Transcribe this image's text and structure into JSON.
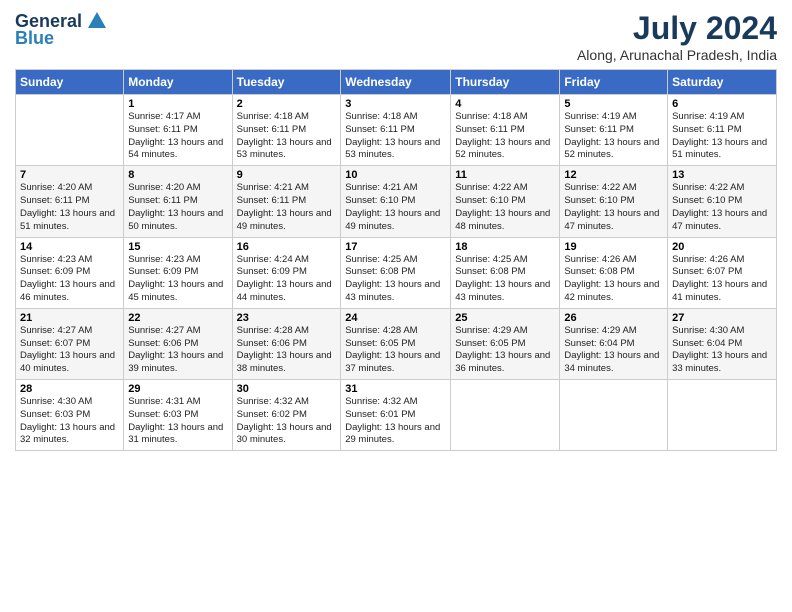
{
  "logo": {
    "general": "General",
    "blue": "Blue"
  },
  "title": "July 2024",
  "subtitle": "Along, Arunachal Pradesh, India",
  "days_of_week": [
    "Sunday",
    "Monday",
    "Tuesday",
    "Wednesday",
    "Thursday",
    "Friday",
    "Saturday"
  ],
  "weeks": [
    [
      {
        "num": "",
        "sunrise": "",
        "sunset": "",
        "daylight": ""
      },
      {
        "num": "1",
        "sunrise": "Sunrise: 4:17 AM",
        "sunset": "Sunset: 6:11 PM",
        "daylight": "Daylight: 13 hours and 54 minutes."
      },
      {
        "num": "2",
        "sunrise": "Sunrise: 4:18 AM",
        "sunset": "Sunset: 6:11 PM",
        "daylight": "Daylight: 13 hours and 53 minutes."
      },
      {
        "num": "3",
        "sunrise": "Sunrise: 4:18 AM",
        "sunset": "Sunset: 6:11 PM",
        "daylight": "Daylight: 13 hours and 53 minutes."
      },
      {
        "num": "4",
        "sunrise": "Sunrise: 4:18 AM",
        "sunset": "Sunset: 6:11 PM",
        "daylight": "Daylight: 13 hours and 52 minutes."
      },
      {
        "num": "5",
        "sunrise": "Sunrise: 4:19 AM",
        "sunset": "Sunset: 6:11 PM",
        "daylight": "Daylight: 13 hours and 52 minutes."
      },
      {
        "num": "6",
        "sunrise": "Sunrise: 4:19 AM",
        "sunset": "Sunset: 6:11 PM",
        "daylight": "Daylight: 13 hours and 51 minutes."
      }
    ],
    [
      {
        "num": "7",
        "sunrise": "Sunrise: 4:20 AM",
        "sunset": "Sunset: 6:11 PM",
        "daylight": "Daylight: 13 hours and 51 minutes."
      },
      {
        "num": "8",
        "sunrise": "Sunrise: 4:20 AM",
        "sunset": "Sunset: 6:11 PM",
        "daylight": "Daylight: 13 hours and 50 minutes."
      },
      {
        "num": "9",
        "sunrise": "Sunrise: 4:21 AM",
        "sunset": "Sunset: 6:11 PM",
        "daylight": "Daylight: 13 hours and 49 minutes."
      },
      {
        "num": "10",
        "sunrise": "Sunrise: 4:21 AM",
        "sunset": "Sunset: 6:10 PM",
        "daylight": "Daylight: 13 hours and 49 minutes."
      },
      {
        "num": "11",
        "sunrise": "Sunrise: 4:22 AM",
        "sunset": "Sunset: 6:10 PM",
        "daylight": "Daylight: 13 hours and 48 minutes."
      },
      {
        "num": "12",
        "sunrise": "Sunrise: 4:22 AM",
        "sunset": "Sunset: 6:10 PM",
        "daylight": "Daylight: 13 hours and 47 minutes."
      },
      {
        "num": "13",
        "sunrise": "Sunrise: 4:22 AM",
        "sunset": "Sunset: 6:10 PM",
        "daylight": "Daylight: 13 hours and 47 minutes."
      }
    ],
    [
      {
        "num": "14",
        "sunrise": "Sunrise: 4:23 AM",
        "sunset": "Sunset: 6:09 PM",
        "daylight": "Daylight: 13 hours and 46 minutes."
      },
      {
        "num": "15",
        "sunrise": "Sunrise: 4:23 AM",
        "sunset": "Sunset: 6:09 PM",
        "daylight": "Daylight: 13 hours and 45 minutes."
      },
      {
        "num": "16",
        "sunrise": "Sunrise: 4:24 AM",
        "sunset": "Sunset: 6:09 PM",
        "daylight": "Daylight: 13 hours and 44 minutes."
      },
      {
        "num": "17",
        "sunrise": "Sunrise: 4:25 AM",
        "sunset": "Sunset: 6:08 PM",
        "daylight": "Daylight: 13 hours and 43 minutes."
      },
      {
        "num": "18",
        "sunrise": "Sunrise: 4:25 AM",
        "sunset": "Sunset: 6:08 PM",
        "daylight": "Daylight: 13 hours and 43 minutes."
      },
      {
        "num": "19",
        "sunrise": "Sunrise: 4:26 AM",
        "sunset": "Sunset: 6:08 PM",
        "daylight": "Daylight: 13 hours and 42 minutes."
      },
      {
        "num": "20",
        "sunrise": "Sunrise: 4:26 AM",
        "sunset": "Sunset: 6:07 PM",
        "daylight": "Daylight: 13 hours and 41 minutes."
      }
    ],
    [
      {
        "num": "21",
        "sunrise": "Sunrise: 4:27 AM",
        "sunset": "Sunset: 6:07 PM",
        "daylight": "Daylight: 13 hours and 40 minutes."
      },
      {
        "num": "22",
        "sunrise": "Sunrise: 4:27 AM",
        "sunset": "Sunset: 6:06 PM",
        "daylight": "Daylight: 13 hours and 39 minutes."
      },
      {
        "num": "23",
        "sunrise": "Sunrise: 4:28 AM",
        "sunset": "Sunset: 6:06 PM",
        "daylight": "Daylight: 13 hours and 38 minutes."
      },
      {
        "num": "24",
        "sunrise": "Sunrise: 4:28 AM",
        "sunset": "Sunset: 6:05 PM",
        "daylight": "Daylight: 13 hours and 37 minutes."
      },
      {
        "num": "25",
        "sunrise": "Sunrise: 4:29 AM",
        "sunset": "Sunset: 6:05 PM",
        "daylight": "Daylight: 13 hours and 36 minutes."
      },
      {
        "num": "26",
        "sunrise": "Sunrise: 4:29 AM",
        "sunset": "Sunset: 6:04 PM",
        "daylight": "Daylight: 13 hours and 34 minutes."
      },
      {
        "num": "27",
        "sunrise": "Sunrise: 4:30 AM",
        "sunset": "Sunset: 6:04 PM",
        "daylight": "Daylight: 13 hours and 33 minutes."
      }
    ],
    [
      {
        "num": "28",
        "sunrise": "Sunrise: 4:30 AM",
        "sunset": "Sunset: 6:03 PM",
        "daylight": "Daylight: 13 hours and 32 minutes."
      },
      {
        "num": "29",
        "sunrise": "Sunrise: 4:31 AM",
        "sunset": "Sunset: 6:03 PM",
        "daylight": "Daylight: 13 hours and 31 minutes."
      },
      {
        "num": "30",
        "sunrise": "Sunrise: 4:32 AM",
        "sunset": "Sunset: 6:02 PM",
        "daylight": "Daylight: 13 hours and 30 minutes."
      },
      {
        "num": "31",
        "sunrise": "Sunrise: 4:32 AM",
        "sunset": "Sunset: 6:01 PM",
        "daylight": "Daylight: 13 hours and 29 minutes."
      },
      {
        "num": "",
        "sunrise": "",
        "sunset": "",
        "daylight": ""
      },
      {
        "num": "",
        "sunrise": "",
        "sunset": "",
        "daylight": ""
      },
      {
        "num": "",
        "sunrise": "",
        "sunset": "",
        "daylight": ""
      }
    ]
  ]
}
